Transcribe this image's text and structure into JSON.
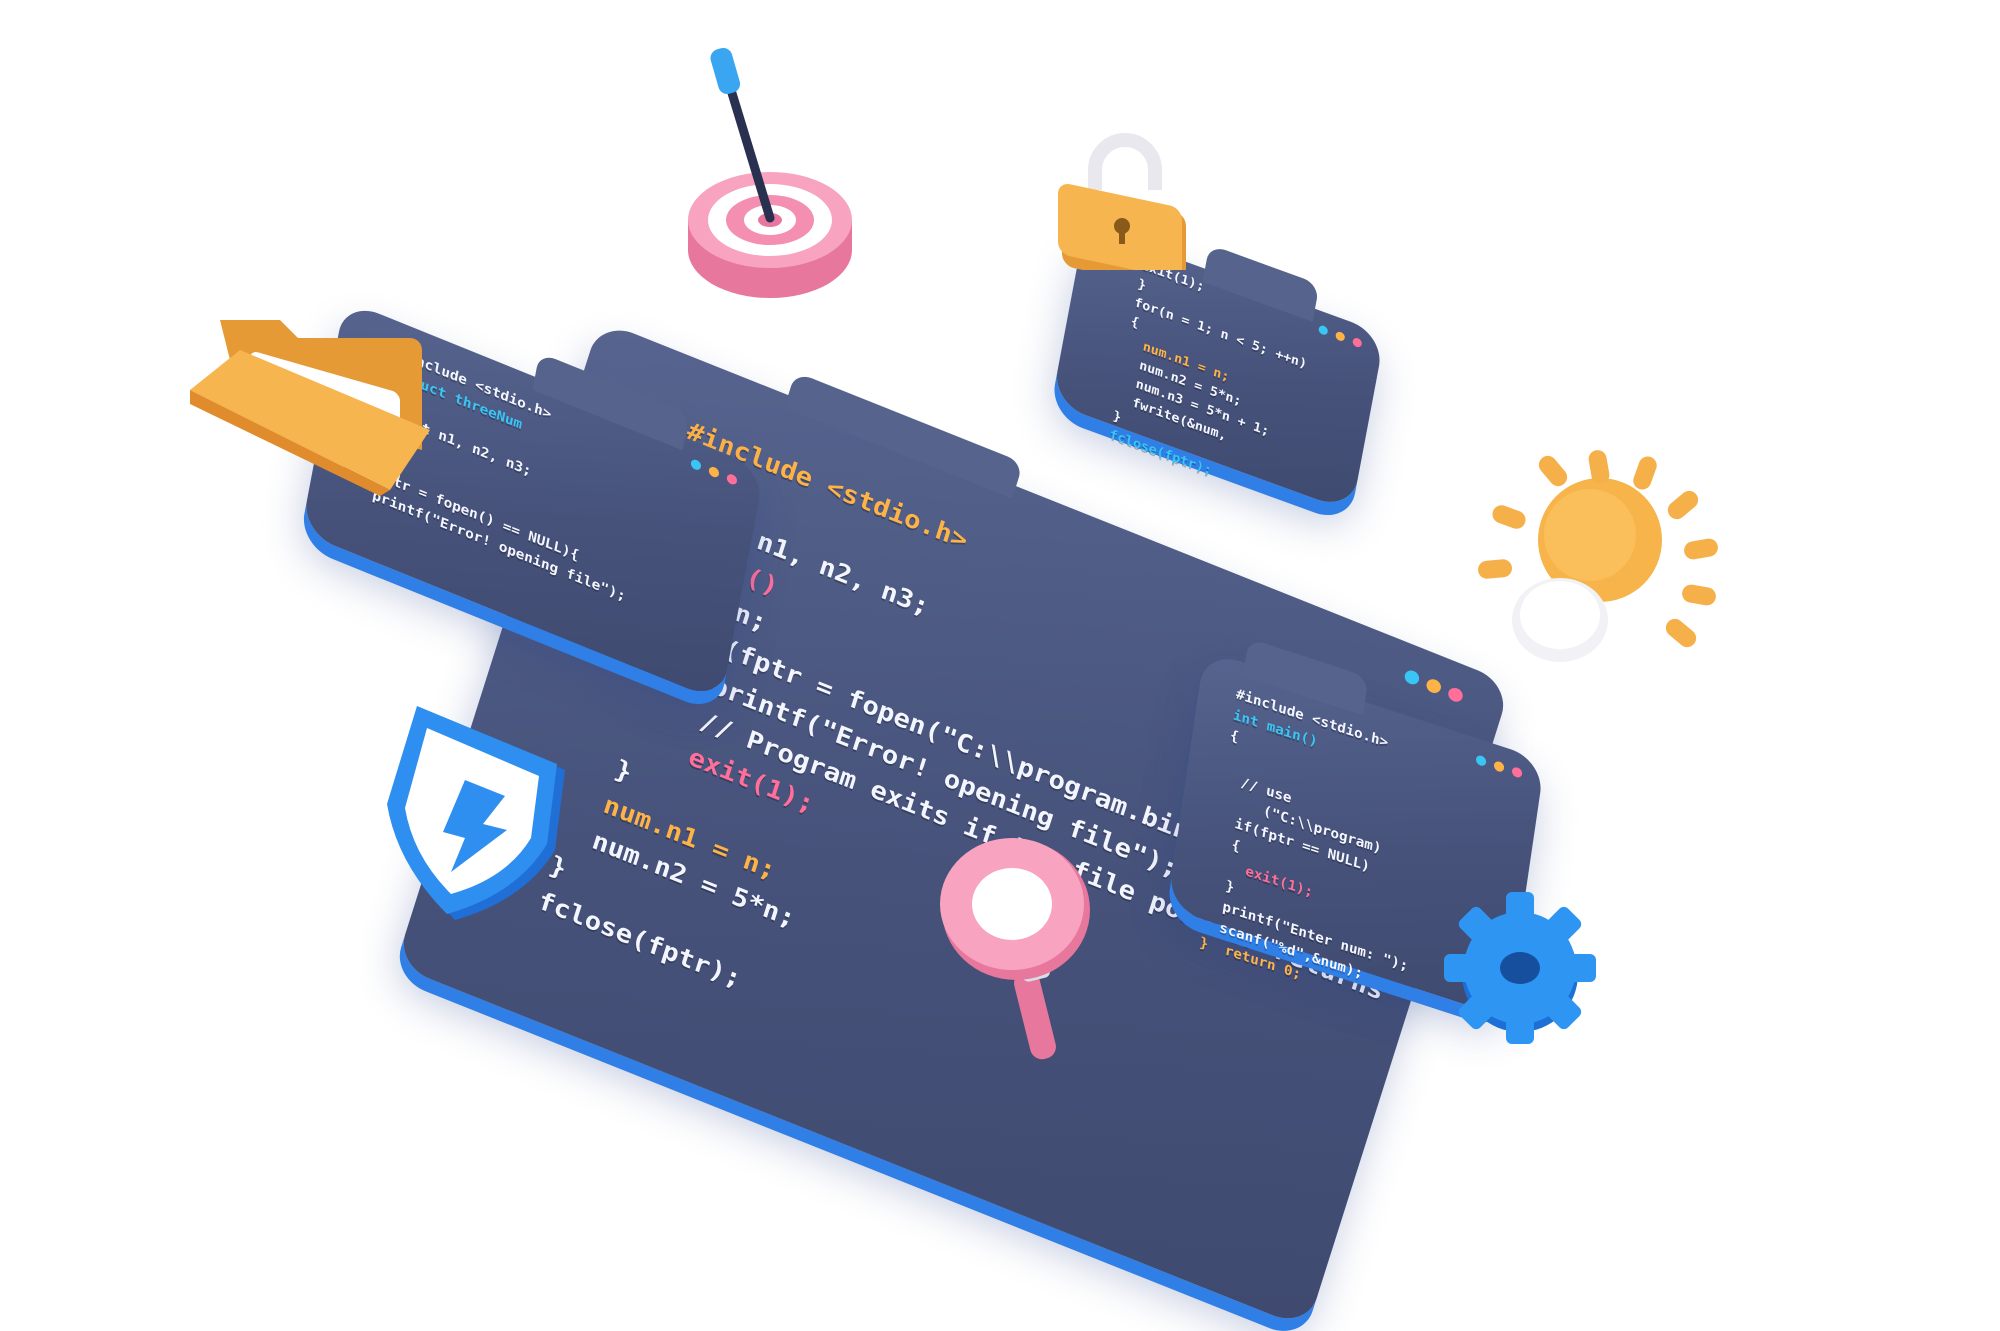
{
  "main_board": {
    "lines": [
      {
        "text": "#include <stdio.h>",
        "tone": "orange"
      },
      {
        "text": "{",
        "tone": "white"
      },
      {
        "text": "  int n1, n2, n3;",
        "tone": "white"
      },
      {
        "text": "} main()",
        "tone": "pink"
      },
      {
        "text": "  int n;",
        "tone": "white"
      },
      {
        "text": "  if ((fptr = fopen(\"C:\\\\program.bin\",\"wb\")) == NULL",
        "tone": "white"
      },
      {
        "text": "      printf(\"Error! opening file\");",
        "tone": "white"
      },
      {
        "text": "      // Program exits if the file pointer returns",
        "tone": "white"
      },
      {
        "text": "      exit(1);",
        "tone": "pink"
      },
      {
        "text": "  }",
        "tone": "white"
      },
      {
        "text": "  num.n1 = n;",
        "tone": "orange"
      },
      {
        "text": "  num.n2 = 5*n;",
        "tone": "white"
      },
      {
        "text": "}",
        "tone": "white"
      },
      {
        "text": "fclose(fptr);",
        "tone": "white"
      }
    ]
  },
  "board_top_left": {
    "lines": [
      {
        "text": "#include <stdio.h>",
        "tone": "white"
      },
      {
        "text": "struct threeNum",
        "tone": "cyan"
      },
      {
        "text": "{",
        "tone": "white"
      },
      {
        "text": "  int n1, n2, n3;",
        "tone": "white"
      },
      {
        "text": "}",
        "tone": "orange"
      },
      {
        "text": "",
        "tone": "white"
      },
      {
        "text": "fptr = fopen() == NULL){",
        "tone": "white"
      },
      {
        "text": "printf(\"Error! opening file\");",
        "tone": "white"
      }
    ]
  },
  "board_top_right": {
    "lines": [
      {
        "text": "exit(1);",
        "tone": "white"
      },
      {
        "text": "}",
        "tone": "white"
      },
      {
        "text": "for(n = 1; n < 5; ++n)",
        "tone": "white"
      },
      {
        "text": "{",
        "tone": "white"
      },
      {
        "text": "  num.n1 = n;",
        "tone": "orange"
      },
      {
        "text": "  num.n2 = 5*n;",
        "tone": "white"
      },
      {
        "text": "  num.n3 = 5*n + 1;",
        "tone": "white"
      },
      {
        "text": "  fwrite(&num,",
        "tone": "white"
      },
      {
        "text": "}",
        "tone": "white"
      },
      {
        "text": "fclose(fptr);",
        "tone": "cyan"
      }
    ]
  },
  "board_bottom_right": {
    "lines": [
      {
        "text": "#include <stdio.h>",
        "tone": "white"
      },
      {
        "text": "int main()",
        "tone": "cyan"
      },
      {
        "text": "{",
        "tone": "white"
      },
      {
        "text": "",
        "tone": "white"
      },
      {
        "text": "  // use",
        "tone": "white"
      },
      {
        "text": "     (\"C:\\\\program)",
        "tone": "white"
      },
      {
        "text": "  if(fptr == NULL)",
        "tone": "white"
      },
      {
        "text": "  {",
        "tone": "white"
      },
      {
        "text": "    exit(1);",
        "tone": "pink"
      },
      {
        "text": "  }",
        "tone": "white"
      },
      {
        "text": "  printf(\"Enter num: \");",
        "tone": "white"
      },
      {
        "text": "  scanf(\"%d\",&num);",
        "tone": "white"
      },
      {
        "text": "}  return 0;",
        "tone": "orange"
      }
    ]
  },
  "colors": {
    "panel": "#4a5680",
    "panel_edge": "#2f7fe6",
    "accent_orange": "#ffb347",
    "accent_cyan": "#39c6f4",
    "accent_pink": "#ff6f9a",
    "folder": "#f6b54e",
    "shield": "#2e8ff0",
    "target": "#f48fb1",
    "gear": "#2a8cf0",
    "bulb": "#f7b44a"
  },
  "icons": [
    "target-icon",
    "lock-icon",
    "folder-icon",
    "lightbulb-icon",
    "shield-icon",
    "magnifier-icon",
    "gear-icon"
  ]
}
